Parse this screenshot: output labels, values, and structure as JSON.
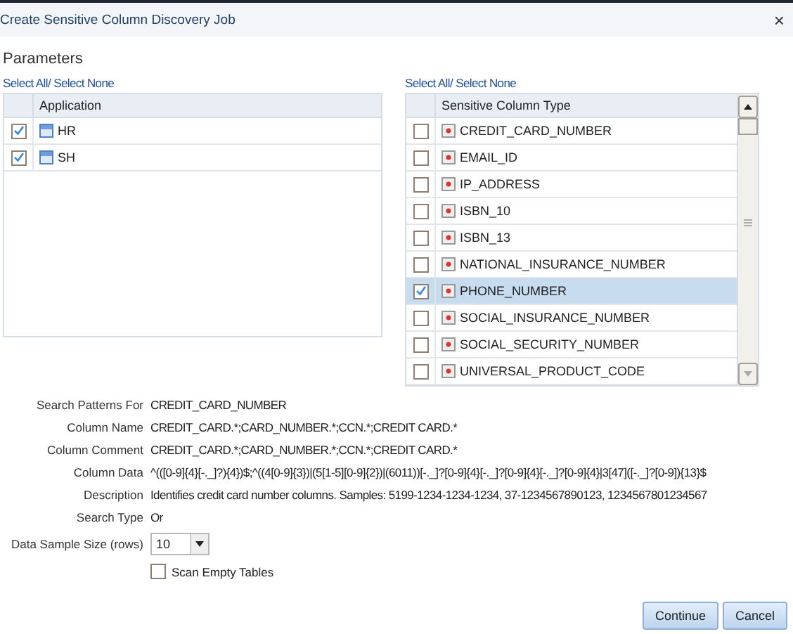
{
  "window": {
    "title": "Create Sensitive Column Discovery Job",
    "close": "×"
  },
  "section_title": "Parameters",
  "applications": {
    "select_link": "Select All/ Select None",
    "column": "Application",
    "rows": [
      {
        "name": "HR",
        "checked": true
      },
      {
        "name": "SH",
        "checked": true
      }
    ]
  },
  "column_types": {
    "select_link": "Select All/ Select None",
    "column": "Sensitive Column Type",
    "rows": [
      {
        "name": "CREDIT_CARD_NUMBER",
        "checked": false,
        "selected": false
      },
      {
        "name": "EMAIL_ID",
        "checked": false,
        "selected": false
      },
      {
        "name": "IP_ADDRESS",
        "checked": false,
        "selected": false
      },
      {
        "name": "ISBN_10",
        "checked": false,
        "selected": false
      },
      {
        "name": "ISBN_13",
        "checked": false,
        "selected": false
      },
      {
        "name": "NATIONAL_INSURANCE_NUMBER",
        "checked": false,
        "selected": false
      },
      {
        "name": "PHONE_NUMBER",
        "checked": true,
        "selected": true
      },
      {
        "name": "SOCIAL_INSURANCE_NUMBER",
        "checked": false,
        "selected": false
      },
      {
        "name": "SOCIAL_SECURITY_NUMBER",
        "checked": false,
        "selected": false
      },
      {
        "name": "UNIVERSAL_PRODUCT_CODE",
        "checked": false,
        "selected": false
      }
    ]
  },
  "details": [
    {
      "label": "Search Patterns For",
      "value": "CREDIT_CARD_NUMBER"
    },
    {
      "label": "Column Name",
      "value": "CREDIT_CARD.*;CARD_NUMBER.*;CCN.*;CREDIT CARD.*"
    },
    {
      "label": "Column Comment",
      "value": "CREDIT_CARD.*;CARD_NUMBER.*;CCN.*;CREDIT CARD.*"
    },
    {
      "label": "Column Data",
      "value": "^(([0-9]{4}[-._]?){4})$;^((4[0-9]{3})|(5[1-5][0-9]{2})|(6011))[-._]?[0-9]{4}[-._]?[0-9]{4}[-._]?[0-9]{4}|3[47]([-._]?[0-9]){13}$"
    },
    {
      "label": "Description",
      "value": "Identifies credit card number columns. Samples: 5199-1234-1234-1234, 37-1234567890123, 1234567801234567"
    },
    {
      "label": "Search Type",
      "value": "Or"
    }
  ],
  "sample_size": {
    "label": "Data Sample Size (rows)",
    "value": "10"
  },
  "scan_empty_tables": {
    "label": "Scan Empty Tables",
    "checked": false
  },
  "buttons": [
    "Continue",
    "Cancel"
  ]
}
